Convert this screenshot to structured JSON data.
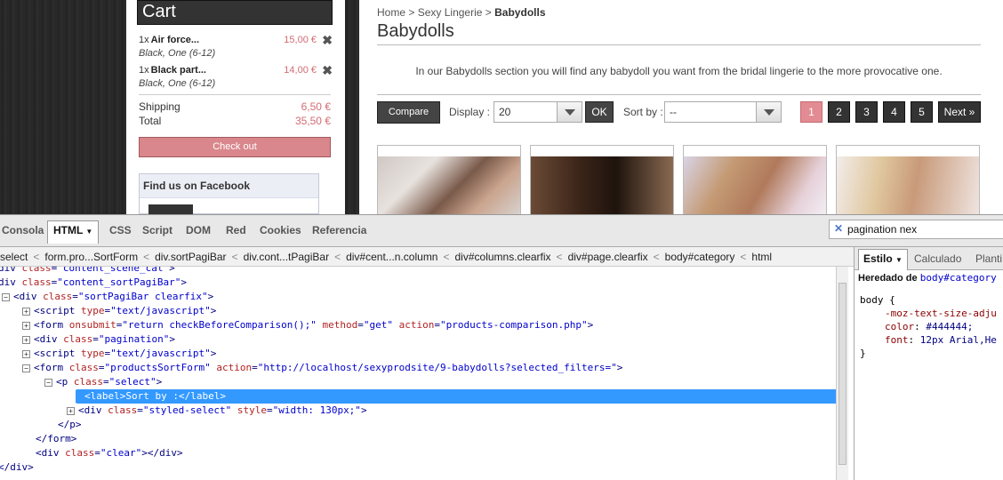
{
  "site": {
    "cart": {
      "title": "Cart",
      "items": [
        {
          "qty": "1x",
          "name": "Air force...",
          "price": "15,00 €",
          "variant": "Black, One (6-12)"
        },
        {
          "qty": "1x",
          "name": "Black part...",
          "price": "14,00 €",
          "variant": "Black, One (6-12)"
        }
      ],
      "shipping_label": "Shipping",
      "shipping_value": "6,50 €",
      "total_label": "Total",
      "total_value": "35,50 €",
      "checkout_label": "Check out",
      "facebook_title": "Find us on Facebook"
    },
    "breadcrumb": {
      "home": "Home",
      "sep": ">",
      "category": "Sexy Lingerie",
      "current": "Babydolls"
    },
    "page_title": "Babydolls",
    "intro": "In our Babydolls section you will find any babydoll you want from the bridal lingerie to the more provocative one.",
    "toolbar": {
      "compare_label": "Compare",
      "display_label": "Display :",
      "display_value": "20",
      "ok_label": "OK",
      "sortby_label": "Sort by :",
      "sortby_value": "--",
      "pages": [
        "1",
        "2",
        "3",
        "4",
        "5"
      ],
      "next_label": "Next »"
    }
  },
  "devtools": {
    "tabs": [
      "Consola",
      "HTML",
      "CSS",
      "Script",
      "DOM",
      "Red",
      "Cookies",
      "Referencia"
    ],
    "active_tab": "HTML",
    "search_value": "pagination nex",
    "path": [
      "select",
      "form.pro...SortForm",
      "div.sortPagiBar",
      "div.cont...tPagiBar",
      "div#cent...n.column",
      "div#columns.clearfix",
      "div#page.clearfix",
      "body#category",
      "html"
    ],
    "tree": [
      {
        "indent": 0,
        "expander": "",
        "html": "<span class='tg'>div</span> <span class='an'>class</span>=<span class='av'>\"content_scene_cat\"</span><span class='tg'>&gt;</span>"
      },
      {
        "indent": 0,
        "expander": "",
        "html": "<span class='tg'>div</span> <span class='an'>class</span>=<span class='av'>\"content_sortPagiBar\"</span><span class='tg'>&gt;</span>"
      },
      {
        "indent": 0,
        "expander": "−",
        "html": "<span class='tg'>&lt;div</span> <span class='an'>class</span>=<span class='av'>\"sortPagiBar clearfix\"</span><span class='tg'>&gt;</span>"
      },
      {
        "indent": 1,
        "expander": "+",
        "html": "<span class='tg'>&lt;script</span> <span class='an'>type</span>=<span class='av'>\"text/javascript\"</span><span class='tg'>&gt;</span>"
      },
      {
        "indent": 1,
        "expander": "+",
        "html": "<span class='tg'>&lt;form</span> <span class='an'>onsubmit</span>=<span class='av'>\"return checkBeforeComparison();\"</span> <span class='an'>method</span>=<span class='av'>\"get\"</span> <span class='an'>action</span>=<span class='av'>\"products-comparison.php\"</span><span class='tg'>&gt;</span>"
      },
      {
        "indent": 1,
        "expander": "+",
        "html": "<span class='tg'>&lt;div</span> <span class='an'>class</span>=<span class='av'>\"pagination\"</span><span class='tg'>&gt;</span>"
      },
      {
        "indent": 1,
        "expander": "+",
        "html": "<span class='tg'>&lt;script</span> <span class='an'>type</span>=<span class='av'>\"text/javascript\"</span><span class='tg'>&gt;</span>"
      },
      {
        "indent": 1,
        "expander": "−",
        "html": "<span class='tg'>&lt;form</span> <span class='an'>class</span>=<span class='av'>\"productsSortForm\"</span> <span class='an'>action</span>=<span class='av'>\"http://localhost/sexyprodsite/9-babydolls?selected_filters=\"</span><span class='tg'>&gt;</span>"
      },
      {
        "indent": 2,
        "expander": "−",
        "html": "<span class='tg'>&lt;p</span> <span class='an'>class</span>=<span class='av'>\"select\"</span><span class='tg'>&gt;</span>"
      },
      {
        "indent": 3,
        "expander": "",
        "selected": true,
        "html": "<span class='tg'>&lt;label&gt;</span><span class='tx'>Sort by :</span><span class='tg'>&lt;/label&gt;</span>"
      },
      {
        "indent": 3,
        "expander": "+",
        "html": "<span class='tg'>&lt;div</span> <span class='an'>class</span>=<span class='av'>\"styled-select\"</span> <span class='an'>style</span>=<span class='av'>\"width: 130px;\"</span><span class='tg'>&gt;</span>"
      },
      {
        "indent": 2,
        "expander": "",
        "html": "<span class='tg'>&lt;/p&gt;</span>"
      },
      {
        "indent": 1,
        "expander": "",
        "html": "<span class='tg'>&lt;/form&gt;</span>"
      },
      {
        "indent": 1,
        "expander": "",
        "html": "<span class='tg'>&lt;div</span> <span class='an'>class</span>=<span class='av'>\"clear\"</span><span class='tg'>&gt;&lt;/div&gt;</span>"
      },
      {
        "indent": 0,
        "expander": "",
        "html": "<span class='tg'>&lt;/div&gt;</span>"
      }
    ],
    "side_tabs": [
      "Estilo",
      "Calculado",
      "Planti"
    ],
    "side_active": "Estilo",
    "inherited_label": "Heredado de",
    "inherited_ref": "body#category",
    "css_selector": "body {",
    "css_props": [
      {
        "prop": "-moz-text-size-adju",
        "val": ""
      },
      {
        "prop": "color",
        "val": "#444444;"
      },
      {
        "prop": "font",
        "val": "12px Arial,He"
      }
    ],
    "css_close": "}"
  }
}
